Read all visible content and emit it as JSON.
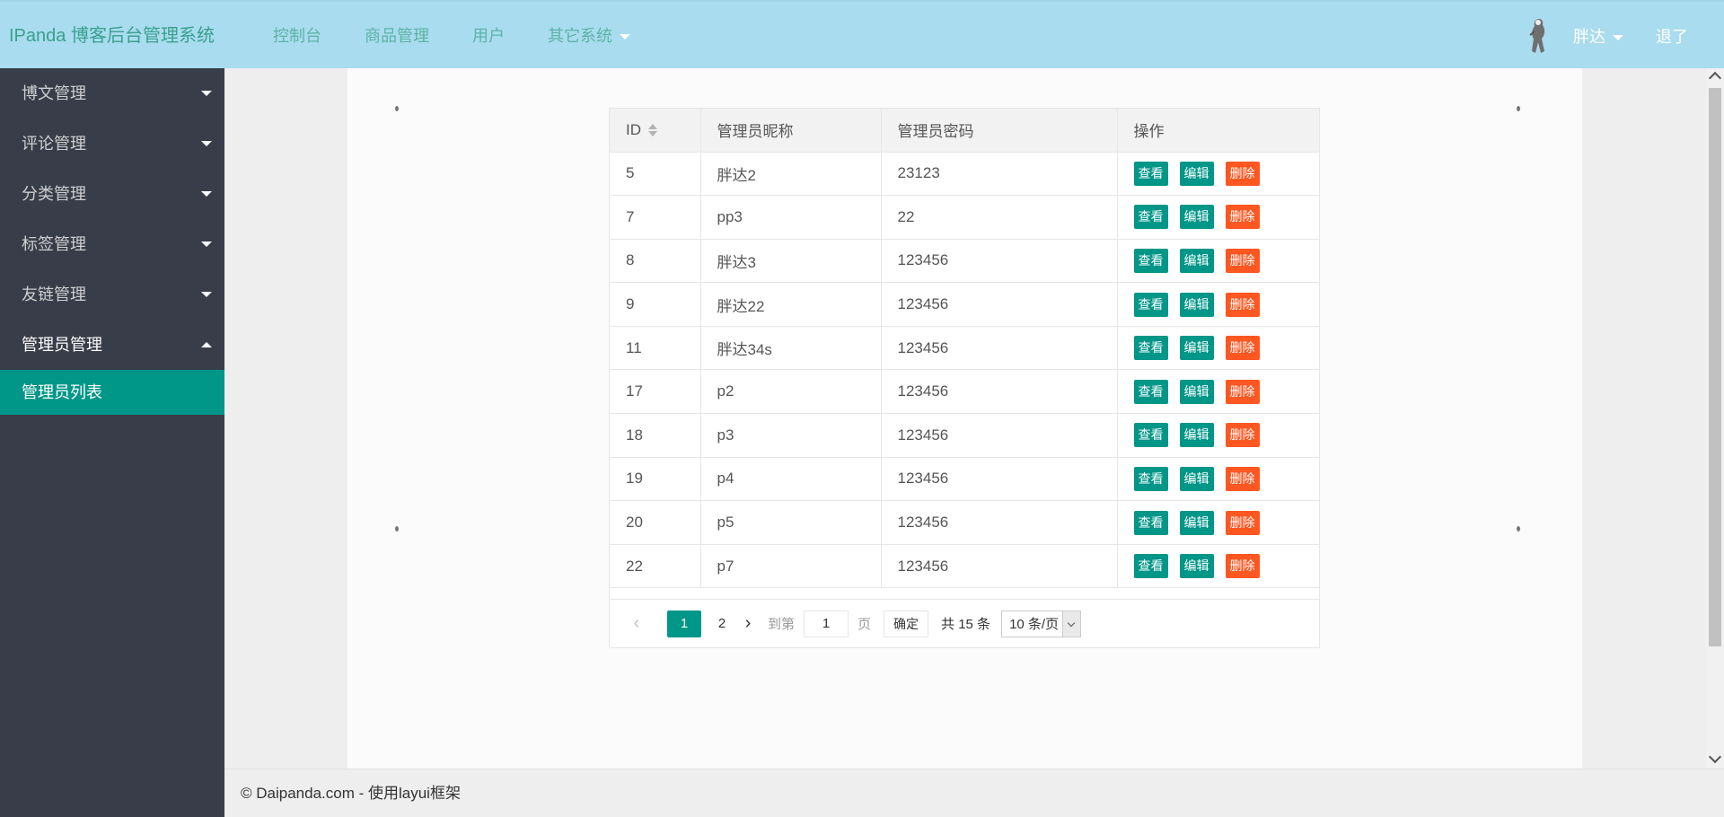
{
  "header": {
    "logo": "IPanda 博客后台管理系统",
    "nav": [
      "控制台",
      "商品管理",
      "用户",
      "其它系统"
    ],
    "user_name": "胖达",
    "logout": "退了"
  },
  "sidebar": {
    "items": [
      {
        "label": "博文管理",
        "expanded": false
      },
      {
        "label": "评论管理",
        "expanded": false
      },
      {
        "label": "分类管理",
        "expanded": false
      },
      {
        "label": "标签管理",
        "expanded": false
      },
      {
        "label": "友链管理",
        "expanded": false
      },
      {
        "label": "管理员管理",
        "expanded": true
      }
    ],
    "active_sub": "管理员列表"
  },
  "table": {
    "columns": [
      "ID",
      "管理员昵称",
      "管理员密码",
      "操作"
    ],
    "actions": {
      "view": "查看",
      "edit": "编辑",
      "delete": "删除"
    },
    "rows": [
      {
        "id": "5",
        "name": "胖达2",
        "password": "23123"
      },
      {
        "id": "7",
        "name": "pp3",
        "password": "22"
      },
      {
        "id": "8",
        "name": "胖达3",
        "password": "123456"
      },
      {
        "id": "9",
        "name": "胖达22",
        "password": "123456"
      },
      {
        "id": "11",
        "name": "胖达34s",
        "password": "123456"
      },
      {
        "id": "17",
        "name": "p2",
        "password": "123456"
      },
      {
        "id": "18",
        "name": "p3",
        "password": "123456"
      },
      {
        "id": "19",
        "name": "p4",
        "password": "123456"
      },
      {
        "id": "20",
        "name": "p5",
        "password": "123456"
      },
      {
        "id": "22",
        "name": "p7",
        "password": "123456"
      }
    ]
  },
  "pager": {
    "current": "1",
    "next_page": "2",
    "skip_label": "到第",
    "skip_value": "1",
    "unit": "页",
    "confirm": "确定",
    "count": "共 15 条",
    "limit": "10 条/页"
  },
  "footer": {
    "text": "© Daipanda.com - 使用layui框架"
  },
  "colors": {
    "header_bg": "#a9dcee",
    "sidebar_bg": "#393d49",
    "accent": "#009688",
    "danger": "#ff5722"
  }
}
